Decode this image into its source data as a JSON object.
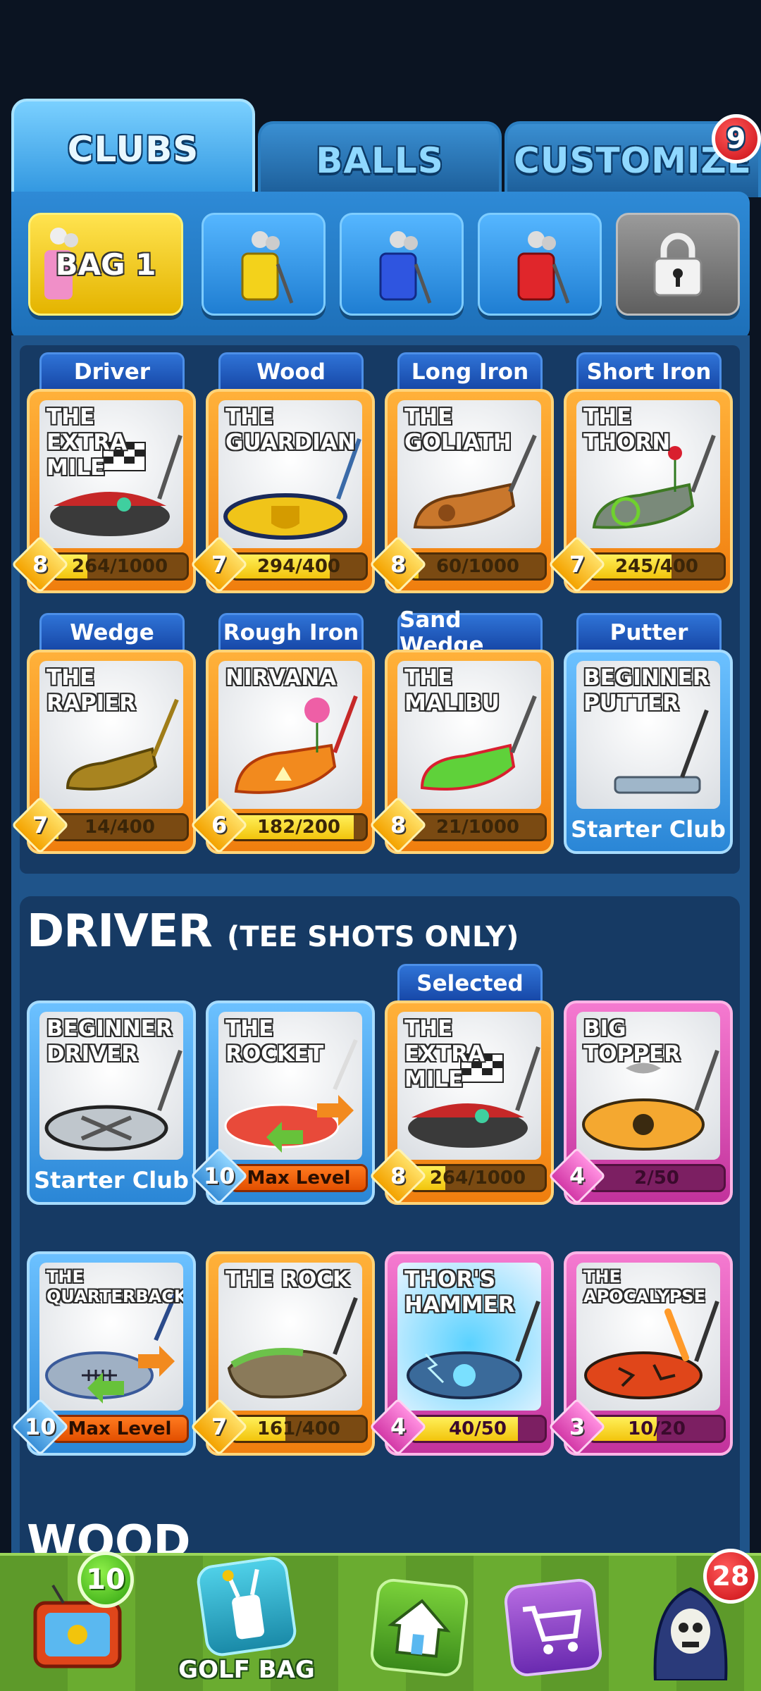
{
  "tabs": {
    "clubs": "CLUBS",
    "balls": "BALLS",
    "customize": "CUSTOMIZE",
    "customize_badge": "9"
  },
  "bags": {
    "selected_label": "BAG 1"
  },
  "equipped": [
    {
      "category": "Driver",
      "name": "THE EXTRA MILE",
      "level": "8",
      "progress": "264/1000",
      "fill": 0.264,
      "rarity": "orange"
    },
    {
      "category": "Wood",
      "name": "THE GUARDIAN",
      "level": "7",
      "progress": "294/400",
      "fill": 0.735,
      "rarity": "orange"
    },
    {
      "category": "Long Iron",
      "name": "THE GOLIATH",
      "level": "8",
      "progress": "60/1000",
      "fill": 0.06,
      "rarity": "orange"
    },
    {
      "category": "Short Iron",
      "name": "THE THORN",
      "level": "7",
      "progress": "245/400",
      "fill": 0.6125,
      "rarity": "orange"
    },
    {
      "category": "Wedge",
      "name": "THE RAPIER",
      "level": "7",
      "progress": "14/400",
      "fill": 0.035,
      "rarity": "orange"
    },
    {
      "category": "Rough Iron",
      "name": "NIRVANA",
      "level": "6",
      "progress": "182/200",
      "fill": 0.91,
      "rarity": "orange"
    },
    {
      "category": "Sand Wedge",
      "name": "THE MALIBU",
      "level": "8",
      "progress": "21/1000",
      "fill": 0.021,
      "rarity": "orange"
    },
    {
      "category": "Putter",
      "name": "BEGINNER PUTTER",
      "starter": "Starter Club",
      "rarity": "blue"
    }
  ],
  "driver_section": {
    "title": "DRIVER",
    "subtitle": "(TEE SHOTS ONLY)",
    "selected_label": "Selected",
    "cards": [
      {
        "name": "BEGINNER DRIVER",
        "starter": "Starter Club",
        "rarity": "blue"
      },
      {
        "name": "THE ROCKET",
        "level": "10",
        "max": "Max Level",
        "rarity": "blue"
      },
      {
        "name": "THE EXTRA MILE",
        "level": "8",
        "progress": "264/1000",
        "fill": 0.264,
        "rarity": "orange"
      },
      {
        "name": "BIG TOPPER",
        "level": "4",
        "progress": "2/50",
        "fill": 0.04,
        "rarity": "pink"
      },
      {
        "name": "THE QUARTERBACK",
        "level": "10",
        "max": "Max Level",
        "rarity": "blue"
      },
      {
        "name": "THE ROCK",
        "level": "7",
        "progress": "161/400",
        "fill": 0.4025,
        "rarity": "orange"
      },
      {
        "name": "THOR'S HAMMER",
        "level": "4",
        "progress": "40/50",
        "fill": 0.8,
        "rarity": "pink"
      },
      {
        "name": "THE APOCALYPSE",
        "level": "3",
        "progress": "10/20",
        "fill": 0.5,
        "rarity": "pink"
      }
    ]
  },
  "next_section_title": "WOOD",
  "bottom_nav": {
    "tv_badge": "10",
    "golf_bag_label": "GOLF BAG",
    "profile_badge": "28"
  }
}
